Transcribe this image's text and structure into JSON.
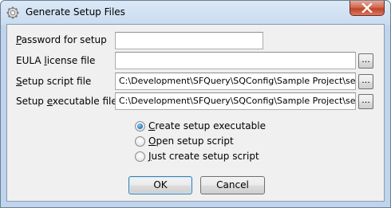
{
  "window": {
    "title": "Generate Setup Files"
  },
  "form": {
    "password": {
      "label_u": "P",
      "label_rest": "assword for setup",
      "value": ""
    },
    "eula": {
      "label_pre": "EULA ",
      "label_u": "l",
      "label_rest": "icense file",
      "value": "",
      "browse": "..."
    },
    "script": {
      "label_u": "S",
      "label_rest": "etup script file",
      "value": "C:\\Development\\SFQuery\\SQConfig\\Sample Project\\se",
      "browse": "..."
    },
    "exe": {
      "label_pre": "Setup ",
      "label_u": "e",
      "label_rest": "xecutable file",
      "value": "C:\\Development\\SFQuery\\SQConfig\\Sample Project\\se",
      "browse": "..."
    }
  },
  "options": [
    {
      "u": "C",
      "rest": "reate setup executable",
      "checked": true
    },
    {
      "u": "O",
      "rest": "pen setup script",
      "checked": false
    },
    {
      "u": "J",
      "rest": "ust create setup script",
      "checked": false
    }
  ],
  "buttons": {
    "ok": "OK",
    "cancel": "Cancel"
  }
}
